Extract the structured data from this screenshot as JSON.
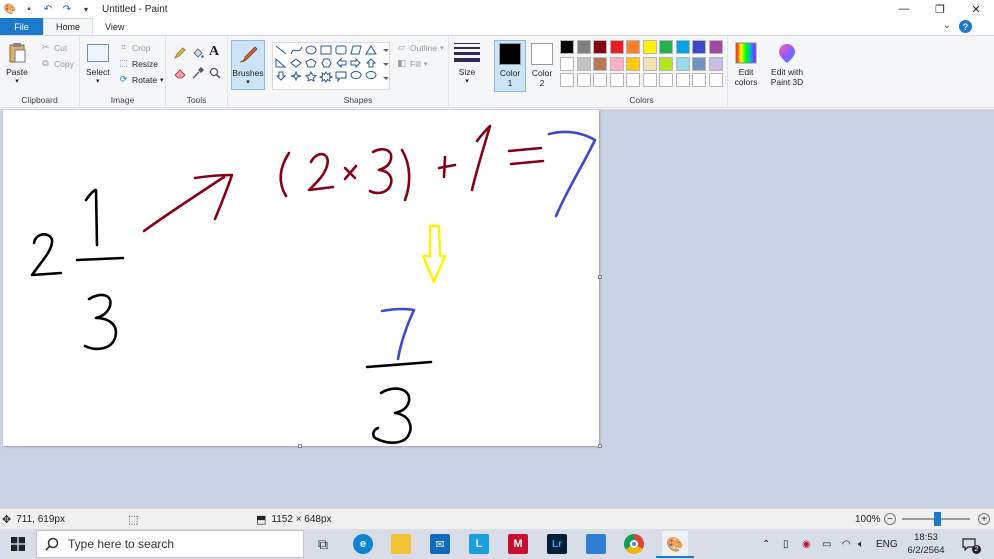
{
  "window": {
    "title": "Untitled - Paint"
  },
  "tabs": {
    "file": "File",
    "home": "Home",
    "view": "View"
  },
  "ribbon": {
    "clipboard": {
      "label": "Clipboard",
      "paste": "Paste",
      "cut": "Cut",
      "copy": "Copy"
    },
    "image": {
      "label": "Image",
      "select": "Select",
      "crop": "Crop",
      "resize": "Resize",
      "rotate": "Rotate"
    },
    "tools": {
      "label": "Tools"
    },
    "brushes": {
      "label": "Brushes"
    },
    "shapes": {
      "label": "Shapes",
      "outline": "Outline",
      "fill": "Fill"
    },
    "size": {
      "label": "Size"
    },
    "color1": {
      "label_line1": "Color",
      "label_line2": "1",
      "value": "#000000"
    },
    "color2": {
      "label_line1": "Color",
      "label_line2": "2",
      "value": "#ffffff"
    },
    "colors": {
      "label": "Colors",
      "row1": [
        "#000000",
        "#7f7f7f",
        "#880015",
        "#ed1c24",
        "#ff7f27",
        "#fff200",
        "#22b14c",
        "#00a2e8",
        "#3f48cc",
        "#a349a4"
      ],
      "row2": [
        "#ffffff",
        "#c3c3c3",
        "#b97a57",
        "#ffaec9",
        "#ffc90e",
        "#efe4b0",
        "#b5e61d",
        "#99d9ea",
        "#7092be",
        "#c8bfe7"
      ],
      "row3": [
        "#ffffff",
        "#ffffff",
        "#ffffff",
        "#ffffff",
        "#ffffff",
        "#ffffff",
        "#ffffff",
        "#ffffff",
        "#ffffff",
        "#ffffff"
      ]
    },
    "edit_colors": {
      "line1": "Edit",
      "line2": "colors"
    },
    "edit_3d": {
      "line1": "Edit with",
      "line2": "Paint 3D"
    }
  },
  "canvas": {
    "ink_colors": {
      "black": "#000000",
      "darkred": "#880015",
      "blue": "#3f48cc",
      "yellow": "#fff200"
    }
  },
  "statusbar": {
    "cursor_position": "711, 619px",
    "canvas_size": "1152 × 648px",
    "zoom": "100%"
  },
  "taskbar": {
    "search_placeholder": "Type here to search",
    "language": "ENG",
    "time": "18:53",
    "date": "6/2/2564",
    "notification_count": "2"
  }
}
